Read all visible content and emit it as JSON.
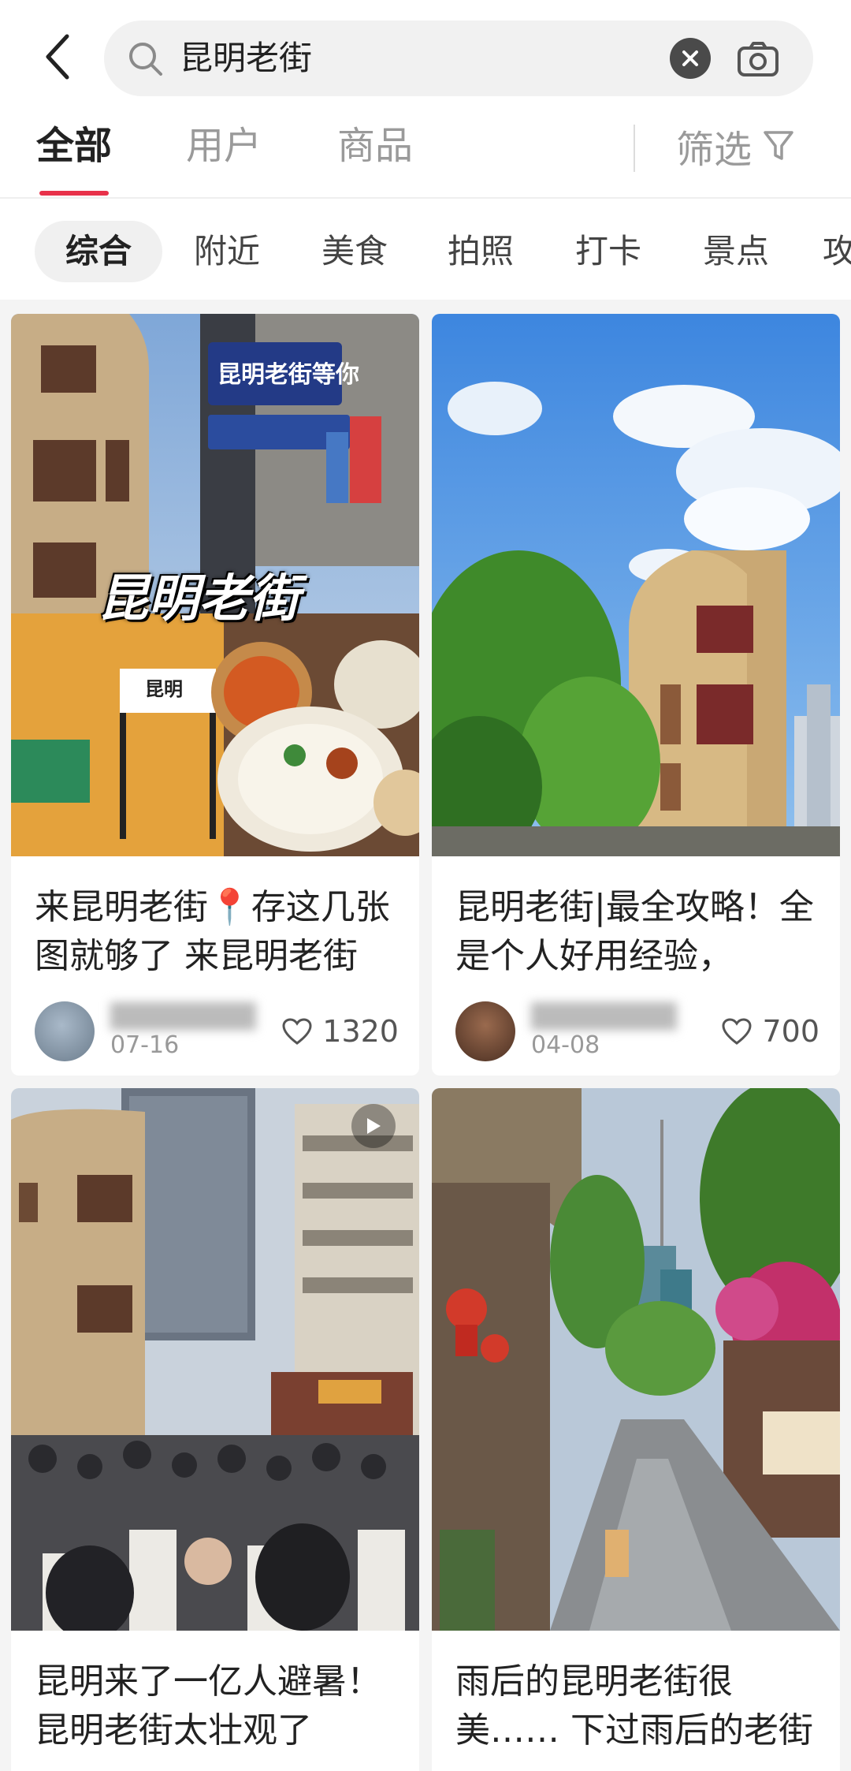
{
  "search": {
    "query": "昆明老街"
  },
  "tabs": [
    {
      "label": "全部",
      "active": true
    },
    {
      "label": "用户",
      "active": false
    },
    {
      "label": "商品",
      "active": false
    }
  ],
  "filter_label": "筛选",
  "chips": [
    {
      "label": "综合",
      "active": true
    },
    {
      "label": "附近",
      "active": false
    },
    {
      "label": "美食",
      "active": false
    },
    {
      "label": "拍照",
      "active": false
    },
    {
      "label": "打卡",
      "active": false
    },
    {
      "label": "景点",
      "active": false
    },
    {
      "label": "攻",
      "active": false
    }
  ],
  "cards": [
    {
      "title": "来昆明老街📍存这几张图就够了 来昆明老街",
      "image_overlay": "昆明老街",
      "image_signs": [
        "昆明老街等你",
        "昆明"
      ],
      "date": "07-16",
      "likes": "1320"
    },
    {
      "title": "昆明老街|最全攻略！全是个人好用经验，",
      "date": "04-08",
      "likes": "700"
    },
    {
      "title": "昆明来了一亿人避暑！昆明老街太壮观了",
      "is_video": true
    },
    {
      "title": "雨后的昆明老街很美…… 下过雨后的老街"
    }
  ],
  "colors": {
    "accent": "#e8314a",
    "text": "#222222",
    "muted": "#9a9a9a",
    "background": "#f4f4f4"
  },
  "icons": [
    "back-arrow-icon",
    "search-icon",
    "clear-icon",
    "camera-icon",
    "filter-icon",
    "heart-icon",
    "play-icon"
  ]
}
